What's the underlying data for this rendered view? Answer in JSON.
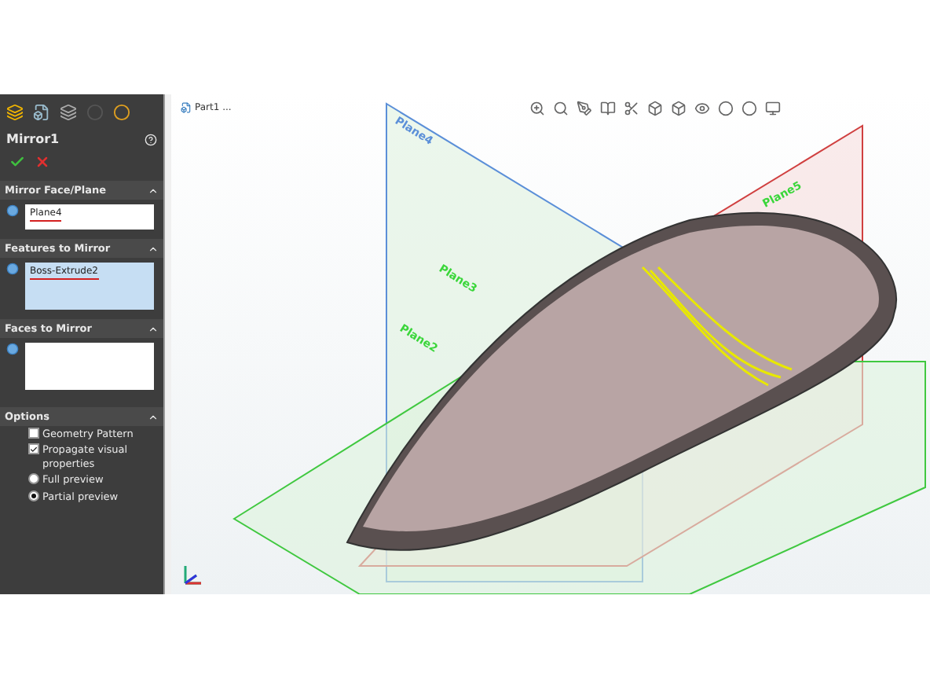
{
  "feature_tree": {
    "label": "Part1 ..."
  },
  "property_manager": {
    "title": "Mirror1",
    "sections": [
      {
        "title": "Mirror Face/Plane",
        "selection": "Plane4",
        "active": false
      },
      {
        "title": "Features to Mirror",
        "selection": "Boss-Extrude2",
        "active": true
      },
      {
        "title": "Faces to Mirror",
        "active": false
      }
    ],
    "options": {
      "title": "Options",
      "items": [
        {
          "kind": "checkbox",
          "label": "Geometry Pattern",
          "checked": false
        },
        {
          "kind": "checkbox",
          "label": "Propagate visual properties",
          "checked": true
        },
        {
          "kind": "radio",
          "label": "Full preview",
          "selected": false
        },
        {
          "kind": "radio",
          "label": "Partial preview",
          "selected": true
        }
      ]
    }
  },
  "viewport": {
    "plane_labels": [
      "Plane4",
      "Plane3",
      "Plane5",
      "Plane2"
    ]
  }
}
